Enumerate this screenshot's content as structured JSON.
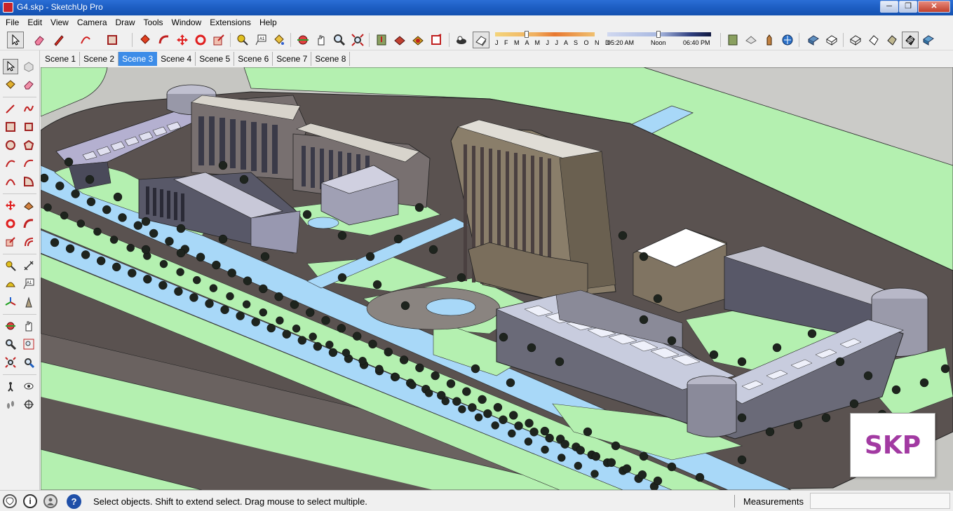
{
  "window": {
    "title": "G4.skp - SketchUp Pro",
    "minimize": "─",
    "maximize": "❐",
    "close": "✕"
  },
  "menu": [
    "File",
    "Edit",
    "View",
    "Camera",
    "Draw",
    "Tools",
    "Window",
    "Extensions",
    "Help"
  ],
  "toolbar": {
    "icons": [
      "select-icon",
      "eraser-icon",
      "pencil-icon",
      "arc-icon",
      "rectangle-icon",
      "push-pull-icon",
      "follow-me-icon",
      "move-icon",
      "rotate-icon",
      "scale-icon",
      "tape-measure-icon",
      "text-icon",
      "paint-bucket-icon",
      "orbit-icon",
      "pan-icon",
      "zoom-icon",
      "zoom-extents-icon",
      "geo-location-icon",
      "add-location-icon",
      "photo-texture-icon",
      "section-plane-icon",
      "shadows-icon",
      "shadow-toggle-icon",
      "warehouse-icon",
      "extension-warehouse-icon",
      "layout-icon",
      "share-icon",
      "xray-icon",
      "back-edges-icon",
      "wireframe-icon",
      "hidden-line-icon",
      "shaded-icon",
      "shaded-textures-icon",
      "monochrome-icon"
    ],
    "shadow_months": "J F M A M J J A S O N D",
    "shadow_time_start": "05:20 AM",
    "shadow_time_mid": "Noon",
    "shadow_time_end": "06:40 PM"
  },
  "left_tools": [
    "select",
    "component",
    "paint",
    "eraser",
    "line",
    "freehand",
    "rectangle",
    "rotated-rectangle",
    "circle",
    "polygon",
    "arc",
    "pie",
    "two-point-arc",
    "three-point-arc",
    "move",
    "push-pull",
    "rotate",
    "follow-me",
    "scale",
    "offset",
    "tape-measure",
    "dimension",
    "protractor",
    "text",
    "axes",
    "3d-text",
    "orbit",
    "pan",
    "zoom",
    "zoom-window",
    "zoom-extents",
    "previous",
    "position-camera",
    "look-around",
    "walk",
    "section-plane"
  ],
  "scenes": {
    "tabs": [
      "Scene 1",
      "Scene 2",
      "Scene 3",
      "Scene 4",
      "Scene 5",
      "Scene 6",
      "Scene 7",
      "Scene 8"
    ],
    "active_index": 2
  },
  "viewport": {
    "watermark": "SKP"
  },
  "status": {
    "message": "Select objects. Shift to extend select. Drag mouse to select multiple.",
    "measurements_label": "Measurements",
    "measurements_value": "",
    "help_glyph": "?",
    "info_glyph": "i"
  },
  "colors": {
    "accent": "#3c8ce8",
    "grass": "#b4f0b0",
    "water": "#a8d8f8",
    "road": "#5a5250",
    "building": "#a89880"
  }
}
